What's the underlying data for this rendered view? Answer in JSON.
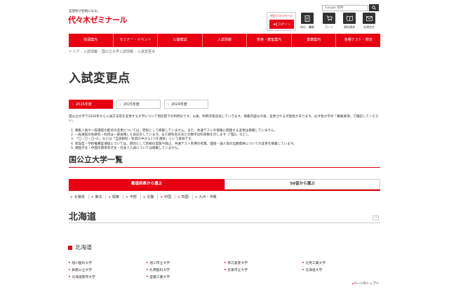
{
  "header": {
    "logo_sub": "志望校が合格になる。",
    "logo_main": "代々木ゼミナール",
    "mypage_label": "代ゼミマイページ",
    "login_label": "ログイン",
    "search_placeholder": "Google 提供",
    "icons": [
      {
        "name": "application-icon",
        "label": "申込・購買"
      },
      {
        "name": "cart-icon",
        "label": "カート"
      },
      {
        "name": "document-request-icon",
        "label": "資料請求"
      },
      {
        "name": "contact-icon",
        "label": "お問合せ"
      }
    ]
  },
  "nav": [
    "受講案内",
    "セミナー・イベント",
    "公開模試",
    "入試情報",
    "校舎・教室案内",
    "書籍案内",
    "各種テスト・検定"
  ],
  "breadcrumb": [
    "トップ",
    "入試情報",
    "国公立大学入試情報",
    "入試変更点"
  ],
  "page_title": "入試変更点",
  "year_tabs": [
    "2026年度",
    "2025年度",
    "2024年度"
  ],
  "intro": "国公立大学で2026年から入試方法等を変更する大学について現段階での判明分です。以後、判明次第追加していきます。掲載内容は今後、変更される可能性があります。必ず各大学の「募集要項」で確認してください。",
  "notes": [
    "1. 募集人員や一般選抜の配点の変更については、原則として掲載していません。また、共通テストの情報に関連する変更は掲載していません。",
    "2. 一般選抜の各教科・科目は一部省略した表記をしています。また教科名のあとの数字は科目数を示します（「理2」など）。",
    "3. 「〇・〇・〇→1」などは「当該教科・科目の中から1つを選択」という意味です。",
    "4. 新設型・学校推薦型選抜については、原則として新規の実施や廃止、共通テスト利用の有無、面接・論入等の出願資格についての変更を掲載しています。",
    "5. 帰国子女・中国引揚者等子女・社会人入試については掲載していません。"
  ],
  "section_title": "国公立大学一覧",
  "mode_tabs": [
    "都道府県から選ぶ",
    "50音から選ぶ"
  ],
  "regions": [
    "北海道",
    "東北",
    "関東",
    "中部",
    "近畿",
    "中国",
    "四国",
    "九州・沖縄"
  ],
  "region_title": "北海道",
  "region_toggle": "－",
  "pref_title": "北海道",
  "universities": [
    [
      "旭川医科大学",
      "旭川市立大学",
      "帯広畜産大学",
      "北見工業大学"
    ],
    [
      "釧路公立大学",
      "札幌医科大学",
      "名寄市立大学",
      "北海道大学"
    ],
    [
      "北海道教育大学",
      "室蘭工業大学"
    ]
  ],
  "pagetop": "ページのトップへ"
}
